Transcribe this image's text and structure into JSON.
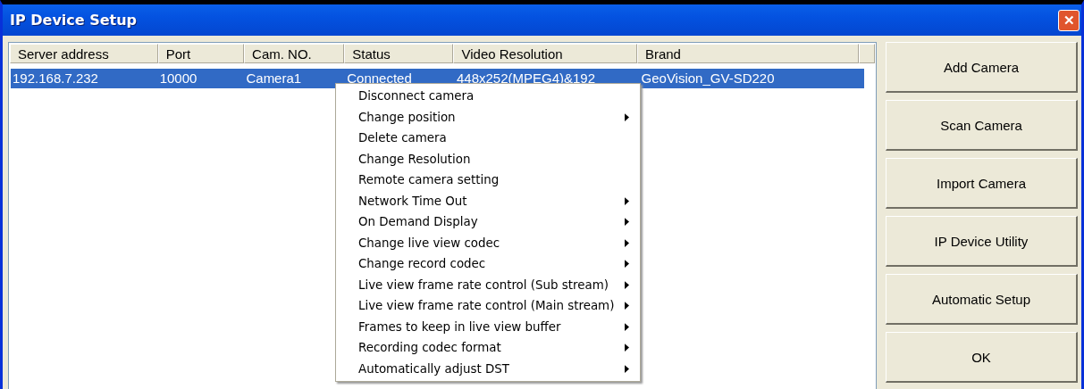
{
  "window": {
    "title": "IP Device Setup",
    "close_label": "✕"
  },
  "table": {
    "columns": [
      "Server address",
      "Port",
      "Cam. NO.",
      "Status",
      "Video Resolution",
      "Brand"
    ],
    "rows": [
      {
        "selected": true,
        "cells": [
          "192.168.7.232",
          "10000",
          "Camera1",
          "Connected",
          "448x252(MPEG4)&192",
          "GeoVision_GV-SD220"
        ]
      }
    ]
  },
  "context_menu": {
    "items": [
      {
        "label": "Disconnect camera",
        "submenu": false
      },
      {
        "label": "Change position",
        "submenu": true
      },
      {
        "label": "Delete camera",
        "submenu": false
      },
      {
        "label": "Change Resolution",
        "submenu": false
      },
      {
        "label": "Remote camera setting",
        "submenu": false
      },
      {
        "label": "Network Time Out",
        "submenu": true
      },
      {
        "label": "On Demand Display",
        "submenu": true
      },
      {
        "label": "Change live view codec",
        "submenu": true
      },
      {
        "label": "Change record codec",
        "submenu": true
      },
      {
        "label": "Live view frame rate control (Sub stream)",
        "submenu": true
      },
      {
        "label": "Live view frame rate control (Main stream)",
        "submenu": true
      },
      {
        "label": "Frames to keep in live view buffer",
        "submenu": true
      },
      {
        "label": "Recording codec format",
        "submenu": true
      },
      {
        "label": "Automatically adjust DST",
        "submenu": true
      }
    ]
  },
  "buttons": [
    "Add Camera",
    "Scan Camera",
    "Import Camera",
    "IP Device Utility",
    "Automatic Setup",
    "OK"
  ]
}
